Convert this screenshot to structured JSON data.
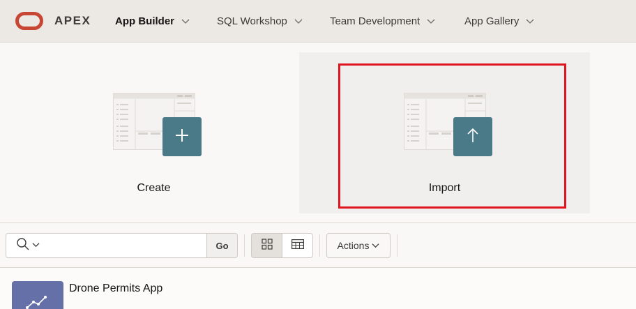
{
  "header": {
    "brand": "APEX",
    "nav": [
      {
        "label": "App Builder",
        "active": true
      },
      {
        "label": "SQL Workshop",
        "active": false
      },
      {
        "label": "Team Development",
        "active": false
      },
      {
        "label": "App Gallery",
        "active": false
      }
    ]
  },
  "tiles": {
    "create": {
      "label": "Create",
      "icon": "plus-icon"
    },
    "import": {
      "label": "Import",
      "icon": "arrow-up-icon",
      "highlighted": true
    }
  },
  "toolbar": {
    "search_value": "",
    "go_label": "Go",
    "actions_label": "Actions",
    "view_mode": "grid"
  },
  "apps": [
    {
      "name": "Drone Permits App"
    }
  ],
  "colors": {
    "brand_logo": "#c74634",
    "tile_accent": "#4a7a87",
    "highlight": "#e0141e",
    "app_icon": "#6570a8"
  }
}
